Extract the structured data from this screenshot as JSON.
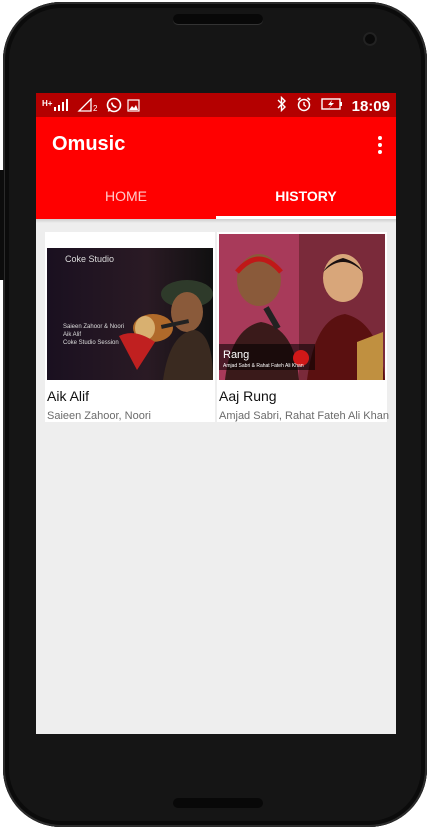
{
  "status_bar": {
    "network_label": "H+",
    "sim_label": "2",
    "time": "18:09",
    "icons": [
      "signal-icon",
      "no-signal-icon",
      "whatsapp-icon",
      "image-icon",
      "bluetooth-icon",
      "alarm-icon",
      "battery-charging-icon"
    ]
  },
  "app_bar": {
    "title": "Omusic",
    "menu_icon": "overflow-menu-icon"
  },
  "tabs": [
    {
      "label": "HOME",
      "active": false
    },
    {
      "label": "HISTORY",
      "active": true
    }
  ],
  "videos": [
    {
      "title": "Aik Alif",
      "subtitle": "Saieen Zahoor, Noori",
      "thumb_caption_top": "Coke Studio",
      "thumb_caption_lines": [
        "Saieen Zahoor & Noori",
        "Aik Alif",
        "Coke Studio Session"
      ]
    },
    {
      "title": "Aaj Rung",
      "subtitle": "Amjad Sabri,  Rahat Fateh Ali Khan",
      "thumb_caption_top": "Rang",
      "thumb_caption_lines": [
        "Amjad Sabri & Rahat Fateh Ali Khan"
      ]
    }
  ],
  "colors": {
    "status_bar": "#b40000",
    "app_bar": "#ff0000",
    "background": "#eeeeee"
  }
}
